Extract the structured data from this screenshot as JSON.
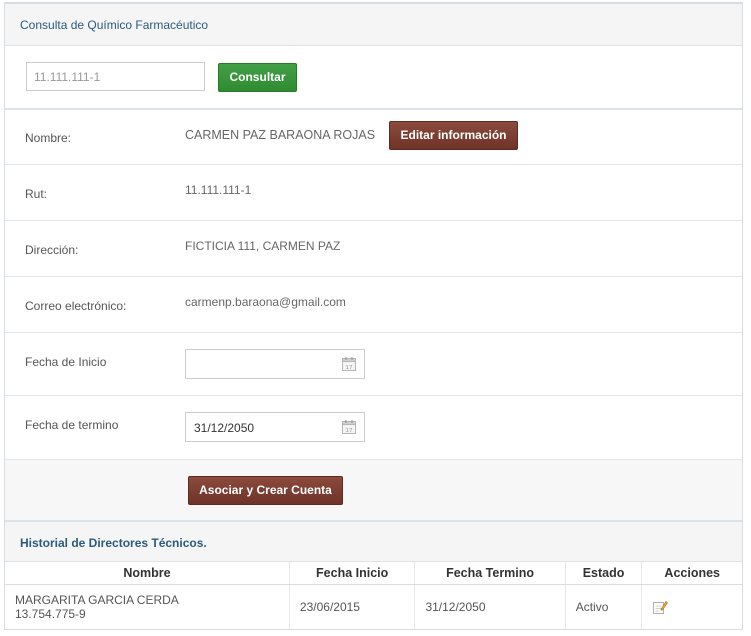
{
  "panel": {
    "title": "Consulta de Químico Farmacéutico"
  },
  "search": {
    "placeholder": "11.111.111-1",
    "button_label": "Consultar"
  },
  "profile": {
    "nombre_label": "Nombre:",
    "nombre_value": "CARMEN PAZ BARAONA ROJAS",
    "edit_button_label": "Editar información",
    "rut_label": "Rut:",
    "rut_value": "11.111.111-1",
    "direccion_label": "Dirección:",
    "direccion_value": "FICTICIA 111, CARMEN PAZ",
    "correo_label": "Correo electrónico:",
    "correo_value": "carmenp.baraona@gmail.com",
    "fecha_inicio_label": "Fecha de Inicio",
    "fecha_inicio_value": "",
    "fecha_termino_label": "Fecha de termino",
    "fecha_termino_value": "31/12/2050",
    "submit_label": "Asociar y Crear Cuenta"
  },
  "history": {
    "title": "Historial de Directores Técnicos.",
    "columns": [
      "Nombre",
      "Fecha Inicio",
      "Fecha Termino",
      "Estado",
      "Acciones"
    ],
    "rows": [
      {
        "nombre": "MARGARITA GARCIA CERDA",
        "rut": "13.754.775-9",
        "fecha_inicio": "23/06/2015",
        "fecha_termino": "31/12/2050",
        "estado": "Activo"
      }
    ]
  },
  "colors": {
    "accent_green": "#2e8b32",
    "accent_brown": "#7a3b30",
    "title_blue": "#2b5a7a"
  },
  "icons": {
    "calendar": "calendar-icon",
    "edit": "edit-icon"
  }
}
